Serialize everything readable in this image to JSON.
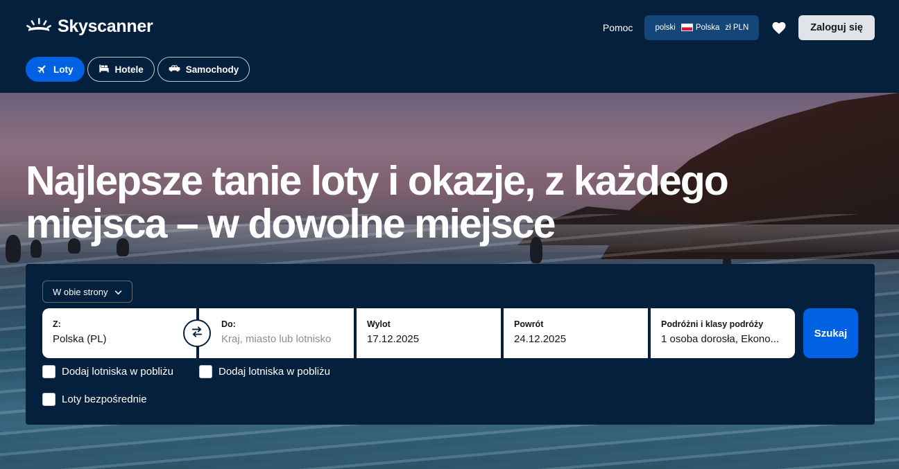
{
  "brand": {
    "name": "Skyscanner"
  },
  "header": {
    "help_label": "Pomoc",
    "locale": {
      "language": "polski",
      "country": "Polska",
      "currency": "zł PLN"
    },
    "login_label": "Zaloguj się"
  },
  "tabs": [
    {
      "label": "Loty",
      "icon": "plane-icon",
      "active": true
    },
    {
      "label": "Hotele",
      "icon": "bed-icon",
      "active": false
    },
    {
      "label": "Samochody",
      "icon": "car-icon",
      "active": false
    }
  ],
  "hero": {
    "headline_line1": "Najlepsze tanie loty i okazje, z każdego",
    "headline_line2": "miejsca – w dowolne miejsce"
  },
  "search": {
    "trip_type": "W obie strony",
    "from": {
      "label": "Z:",
      "value": "Polska (PL)"
    },
    "to": {
      "label": "Do:",
      "placeholder": "Kraj, miasto lub lotnisko"
    },
    "depart": {
      "label": "Wylot",
      "value": "17.12.2025"
    },
    "return": {
      "label": "Powrót",
      "value": "24.12.2025"
    },
    "travellers": {
      "label": "Podróżni i klasy podróży",
      "value": "1 osoba dorosła, Ekono..."
    },
    "search_label": "Szukaj",
    "options": {
      "nearby_from": "Dodaj lotniska w pobliżu",
      "nearby_to": "Dodaj lotniska w pobliżu",
      "direct": "Loty bezpośrednie"
    }
  },
  "colors": {
    "navy": "#05203c",
    "accent_blue": "#0062e3",
    "locale_bg": "#154679"
  }
}
